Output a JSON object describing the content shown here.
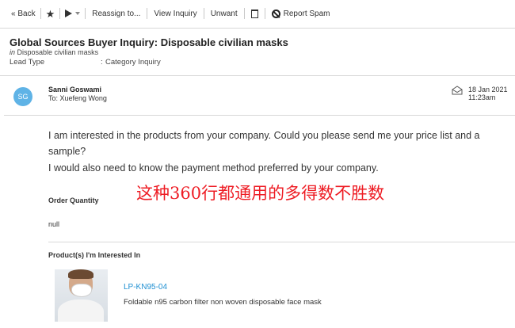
{
  "toolbar": {
    "back_label": "« Back",
    "reassign_label": "Reassign to...",
    "view_inquiry_label": "View Inquiry",
    "unwant_label": "Unwant",
    "report_spam_label": "Report Spam"
  },
  "inquiry": {
    "subject": "Global Sources Buyer Inquiry: Disposable civilian masks",
    "in_prefix": "in",
    "category": "Disposable civilian masks",
    "lead_type_label": "Lead Type",
    "lead_type_colon": ":",
    "lead_type_value": "Category Inquiry"
  },
  "message": {
    "avatar_initials": "SG",
    "sender_name": "Sanni Goswami",
    "recipient": "To: Xuefeng Wong",
    "date": "18 Jan 2021",
    "time": "11:23am",
    "body_lines": [
      "I am interested in the products from your company. Could you please send me your price list and a",
      "sample?",
      "I would also need to know the payment method preferred by your company."
    ],
    "overlay_text": "这种360行都通用的多得数不胜数"
  },
  "order": {
    "label": "Order Quantity",
    "value": "null"
  },
  "products": {
    "label": "Product(s) I'm Interested In",
    "items": [
      {
        "code": "LP-KN95-04",
        "description": "Foldable n95 carbon filter non woven disposable face mask"
      }
    ]
  },
  "colors": {
    "link": "#1e8fd2",
    "avatar_bg": "#5fb3e6",
    "overlay": "#ee1c24"
  }
}
